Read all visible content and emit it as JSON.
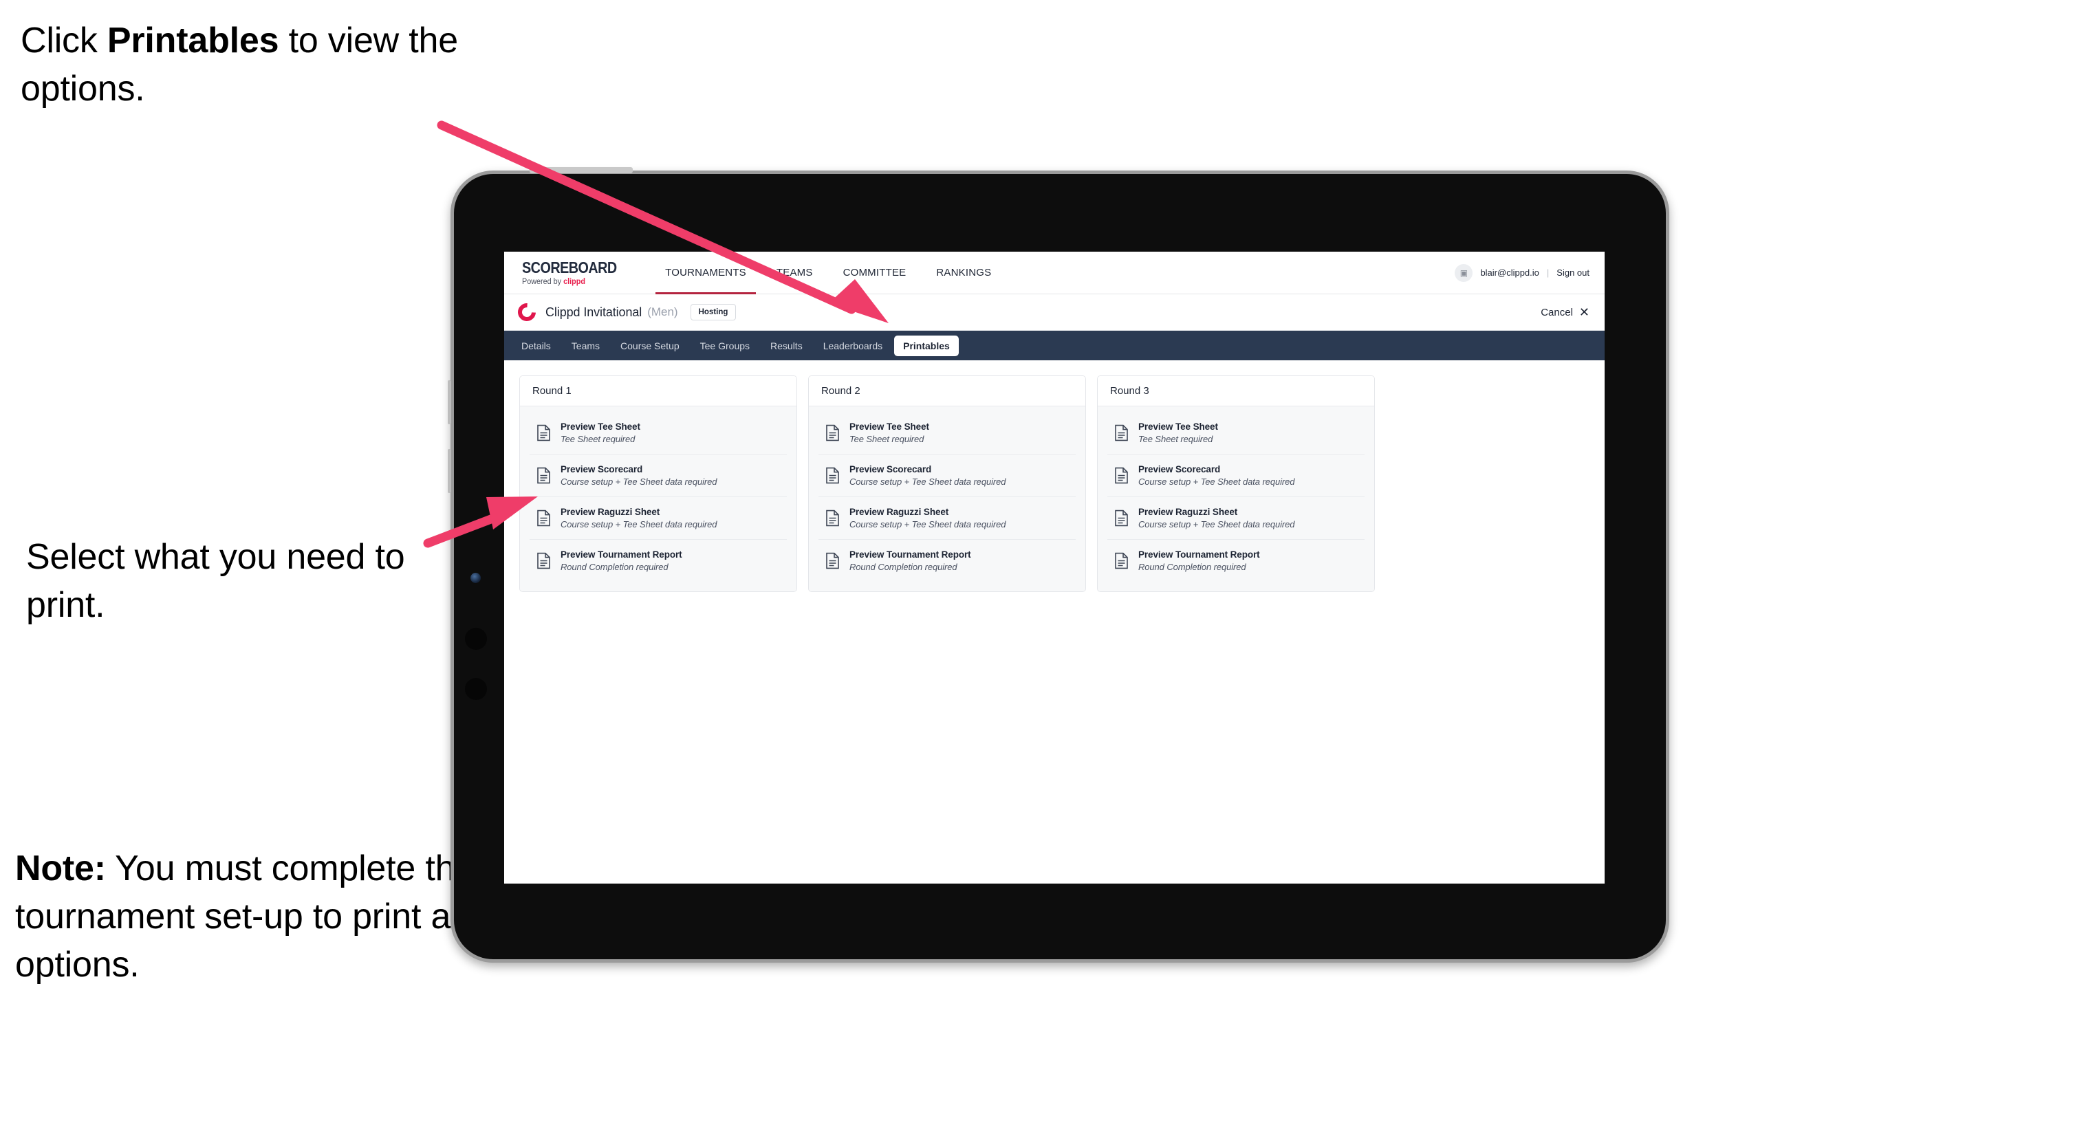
{
  "annotations": [
    {
      "id": "cap-1",
      "prefix": "Click ",
      "bold": "Printables",
      "suffix": " to view the options."
    },
    {
      "id": "cap-2",
      "text": "Select what you\nneed to print."
    },
    {
      "id": "cap-3",
      "bold": "Note:",
      "text": " You must complete the tournament set-up to print all the options."
    }
  ],
  "colors": {
    "arrow_pink": "#ef3d69",
    "tab_bar": "#2b3a52",
    "brand_pink": "#e8224f",
    "clippd_red": "#e0174c",
    "nav_underline": "#b4243f"
  },
  "app": {
    "brand": {
      "title": "SCOREBOARD",
      "powered_prefix": "Powered by ",
      "powered_name": "clippd"
    },
    "top_nav": [
      {
        "label": "TOURNAMENTS",
        "active": true
      },
      {
        "label": "TEAMS",
        "active": false
      },
      {
        "label": "COMMITTEE",
        "active": false
      },
      {
        "label": "RANKINGS",
        "active": false
      }
    ],
    "account": {
      "email": "blair@clippd.io",
      "separator": "|",
      "sign_out": "Sign out",
      "avatar_glyph": "▣"
    },
    "tournament": {
      "name": "Clippd Invitational",
      "gender": "(Men)",
      "status_badge": "Hosting",
      "cancel_label": "Cancel",
      "cancel_glyph": "✕"
    },
    "tabs": [
      {
        "label": "Details",
        "active": false
      },
      {
        "label": "Teams",
        "active": false
      },
      {
        "label": "Course Setup",
        "active": false
      },
      {
        "label": "Tee Groups",
        "active": false
      },
      {
        "label": "Results",
        "active": false
      },
      {
        "label": "Leaderboards",
        "active": false
      },
      {
        "label": "Printables",
        "active": true
      }
    ],
    "rounds": [
      {
        "title": "Round 1",
        "items": [
          {
            "title": "Preview Tee Sheet",
            "requirement": "Tee Sheet required"
          },
          {
            "title": "Preview Scorecard",
            "requirement": "Course setup + Tee Sheet data required"
          },
          {
            "title": "Preview Raguzzi Sheet",
            "requirement": "Course setup + Tee Sheet data required"
          },
          {
            "title": "Preview Tournament Report",
            "requirement": "Round Completion required"
          }
        ]
      },
      {
        "title": "Round 2",
        "items": [
          {
            "title": "Preview Tee Sheet",
            "requirement": "Tee Sheet required"
          },
          {
            "title": "Preview Scorecard",
            "requirement": "Course setup + Tee Sheet data required"
          },
          {
            "title": "Preview Raguzzi Sheet",
            "requirement": "Course setup + Tee Sheet data required"
          },
          {
            "title": "Preview Tournament Report",
            "requirement": "Round Completion required"
          }
        ]
      },
      {
        "title": "Round 3",
        "items": [
          {
            "title": "Preview Tee Sheet",
            "requirement": "Tee Sheet required"
          },
          {
            "title": "Preview Scorecard",
            "requirement": "Course setup + Tee Sheet data required"
          },
          {
            "title": "Preview Raguzzi Sheet",
            "requirement": "Course setup + Tee Sheet data required"
          },
          {
            "title": "Preview Tournament Report",
            "requirement": "Round Completion required"
          }
        ]
      }
    ]
  }
}
